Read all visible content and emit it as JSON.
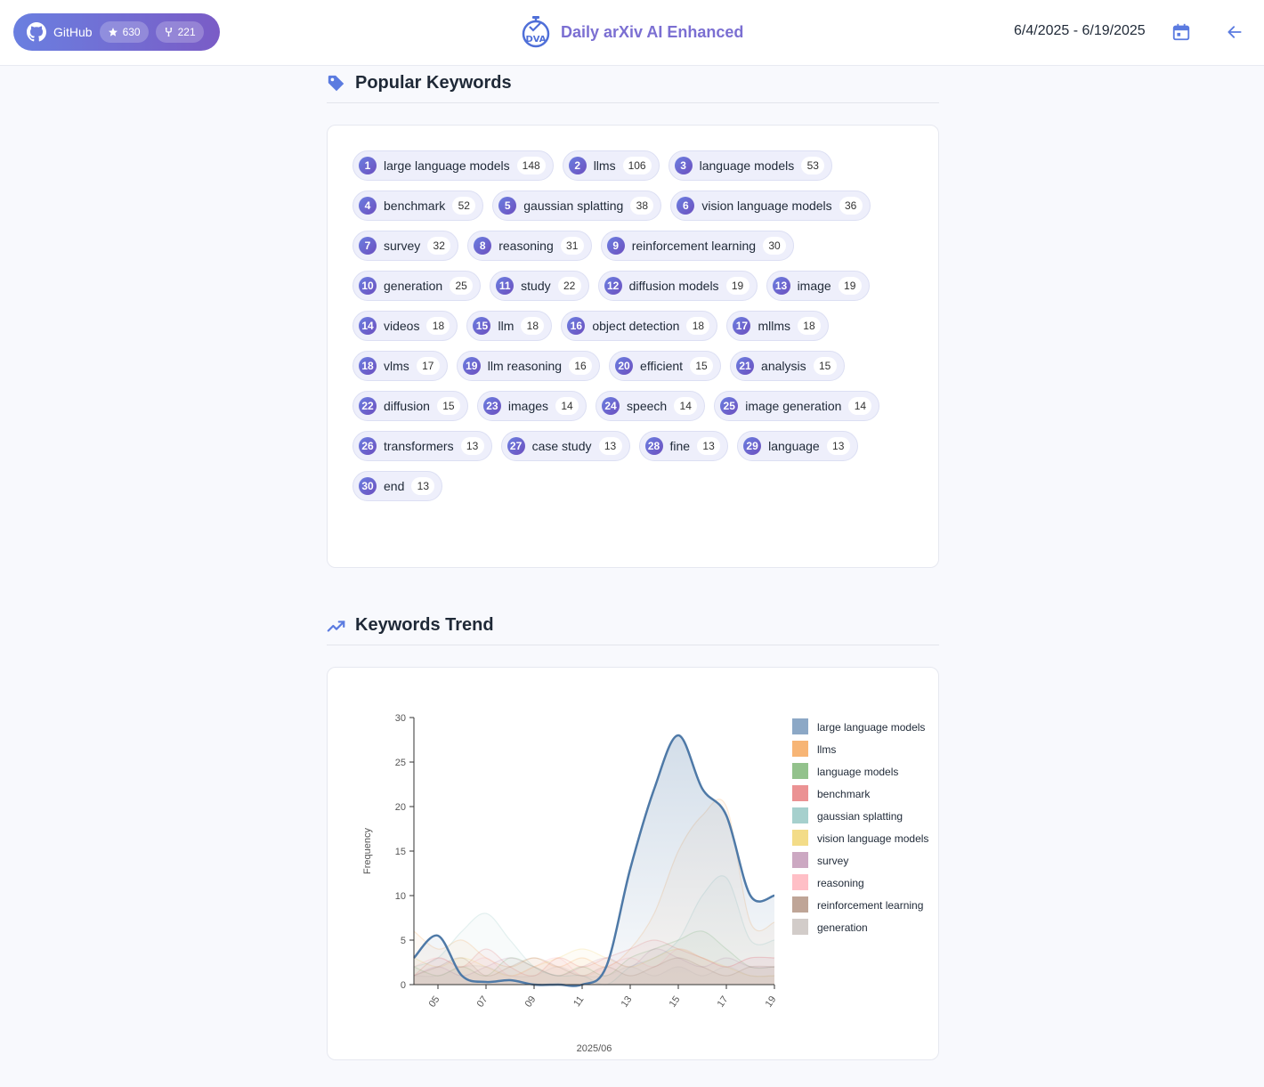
{
  "header": {
    "github": {
      "label": "GitHub",
      "stars": "630",
      "forks": "221"
    },
    "brand": {
      "title": "Daily arXiv AI Enhanced",
      "logo_icon": "stopwatch-dva-logo-icon"
    },
    "date_range": "6/4/2025 - 6/19/2025",
    "calendar_icon": "calendar-icon",
    "back_icon": "arrow-left-icon"
  },
  "popular": {
    "title": "Popular Keywords",
    "icon": "tag-icon",
    "keywords": [
      {
        "rank": "1",
        "label": "large language models",
        "count": "148"
      },
      {
        "rank": "2",
        "label": "llms",
        "count": "106"
      },
      {
        "rank": "3",
        "label": "language models",
        "count": "53"
      },
      {
        "rank": "4",
        "label": "benchmark",
        "count": "52"
      },
      {
        "rank": "5",
        "label": "gaussian splatting",
        "count": "38"
      },
      {
        "rank": "6",
        "label": "vision language models",
        "count": "36"
      },
      {
        "rank": "7",
        "label": "survey",
        "count": "32"
      },
      {
        "rank": "8",
        "label": "reasoning",
        "count": "31"
      },
      {
        "rank": "9",
        "label": "reinforcement learning",
        "count": "30"
      },
      {
        "rank": "10",
        "label": "generation",
        "count": "25"
      },
      {
        "rank": "11",
        "label": "study",
        "count": "22"
      },
      {
        "rank": "12",
        "label": "diffusion models",
        "count": "19"
      },
      {
        "rank": "13",
        "label": "image",
        "count": "19"
      },
      {
        "rank": "14",
        "label": "videos",
        "count": "18"
      },
      {
        "rank": "15",
        "label": "llm",
        "count": "18"
      },
      {
        "rank": "16",
        "label": "object detection",
        "count": "18"
      },
      {
        "rank": "17",
        "label": "mllms",
        "count": "18"
      },
      {
        "rank": "18",
        "label": "vlms",
        "count": "17"
      },
      {
        "rank": "19",
        "label": "llm reasoning",
        "count": "16"
      },
      {
        "rank": "20",
        "label": "efficient",
        "count": "15"
      },
      {
        "rank": "21",
        "label": "analysis",
        "count": "15"
      },
      {
        "rank": "22",
        "label": "diffusion",
        "count": "15"
      },
      {
        "rank": "23",
        "label": "images",
        "count": "14"
      },
      {
        "rank": "24",
        "label": "speech",
        "count": "14"
      },
      {
        "rank": "25",
        "label": "image generation",
        "count": "14"
      },
      {
        "rank": "26",
        "label": "transformers",
        "count": "13"
      },
      {
        "rank": "27",
        "label": "case study",
        "count": "13"
      },
      {
        "rank": "28",
        "label": "fine",
        "count": "13"
      },
      {
        "rank": "29",
        "label": "language",
        "count": "13"
      },
      {
        "rank": "30",
        "label": "end",
        "count": "13"
      }
    ]
  },
  "trend": {
    "title": "Keywords Trend",
    "icon": "trend-line-icon"
  },
  "chart_data": {
    "type": "area",
    "xlabel": "2025/06",
    "ylabel": "Frequency",
    "ylim": [
      0,
      30
    ],
    "yticks": [
      0,
      5,
      10,
      15,
      20,
      25,
      30
    ],
    "x": [
      4,
      5,
      6,
      7,
      8,
      9,
      10,
      11,
      12,
      13,
      14,
      15,
      16,
      17,
      18,
      19
    ],
    "xticks": [
      "05",
      "07",
      "09",
      "11",
      "13",
      "15",
      "17",
      "19"
    ],
    "xtick_values": [
      5,
      7,
      9,
      11,
      13,
      15,
      17,
      19
    ],
    "legend_position": "right",
    "highlighted_series": "large language models",
    "series": [
      {
        "name": "large language models",
        "color": "#4e79a7",
        "values": [
          3,
          5.5,
          1,
          0.3,
          0.5,
          0,
          0,
          0,
          2,
          13,
          22,
          28,
          22,
          19,
          10,
          10
        ]
      },
      {
        "name": "llms",
        "color": "#f28e2b",
        "values": [
          6,
          4,
          5,
          3,
          2,
          3,
          2,
          3,
          2,
          4,
          8,
          15,
          19,
          20,
          7,
          7
        ]
      },
      {
        "name": "language models",
        "color": "#59a14f",
        "values": [
          2,
          1,
          2,
          1,
          3,
          2,
          1,
          2,
          1,
          3,
          4,
          5,
          6,
          4,
          2,
          2
        ]
      },
      {
        "name": "benchmark",
        "color": "#e15759",
        "values": [
          1,
          3,
          2,
          4,
          2,
          1,
          3,
          2,
          3,
          4,
          5,
          4,
          3,
          2,
          3,
          3
        ]
      },
      {
        "name": "gaussian splatting",
        "color": "#76b7b2",
        "values": [
          2,
          3,
          6,
          8,
          5,
          2,
          1,
          1,
          0,
          2,
          3,
          5,
          10,
          12,
          5,
          5
        ]
      },
      {
        "name": "vision language models",
        "color": "#edc948",
        "values": [
          3,
          2,
          3,
          2,
          1,
          2,
          3,
          4,
          3,
          2,
          3,
          4,
          3,
          2,
          1,
          1
        ]
      },
      {
        "name": "survey",
        "color": "#b07aa1",
        "values": [
          1,
          2,
          1,
          2,
          3,
          2,
          1,
          2,
          3,
          2,
          4,
          3,
          2,
          3,
          2,
          2
        ]
      },
      {
        "name": "reasoning",
        "color": "#ff9da7",
        "values": [
          2,
          3,
          2,
          3,
          1,
          2,
          3,
          1,
          2,
          3,
          2,
          4,
          3,
          2,
          3,
          3
        ]
      },
      {
        "name": "reinforcement learning",
        "color": "#9c755f",
        "values": [
          1,
          2,
          3,
          1,
          2,
          3,
          2,
          1,
          2,
          1,
          2,
          3,
          2,
          1,
          2,
          2
        ]
      },
      {
        "name": "generation",
        "color": "#bab0ac",
        "values": [
          1,
          1,
          2,
          2,
          1,
          1,
          2,
          1,
          1,
          2,
          1,
          2,
          1,
          2,
          1,
          1
        ]
      }
    ]
  }
}
